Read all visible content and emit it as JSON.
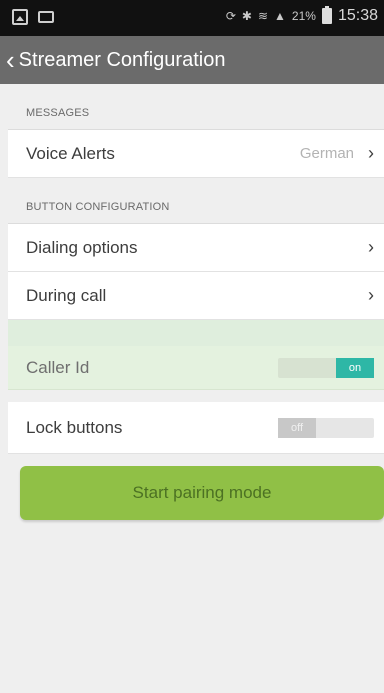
{
  "statusbar": {
    "battery_percent": "21%",
    "time": "15:38"
  },
  "actionbar": {
    "back_glyph": "‹",
    "title": "Streamer Configuration"
  },
  "sections": {
    "messages": {
      "header": "MESSAGES",
      "voice_alerts": {
        "label": "Voice Alerts",
        "value": "German"
      }
    },
    "buttons": {
      "header": "BUTTON CONFIGURATION",
      "dialing": {
        "label": "Dialing options"
      },
      "during_call": {
        "label": "During call"
      },
      "caller_id": {
        "label": "Caller Id",
        "state": "on"
      },
      "lock_buttons": {
        "label": "Lock buttons",
        "state": "off"
      }
    }
  },
  "pair_button": {
    "label": "Start pairing mode"
  },
  "colors": {
    "actionbar": "#6b6b6b",
    "toggle_on": "#2eb7a6",
    "pair_button": "#90c046",
    "highlight_row": "#e4f2df"
  },
  "icons": {
    "chevron": "›"
  }
}
